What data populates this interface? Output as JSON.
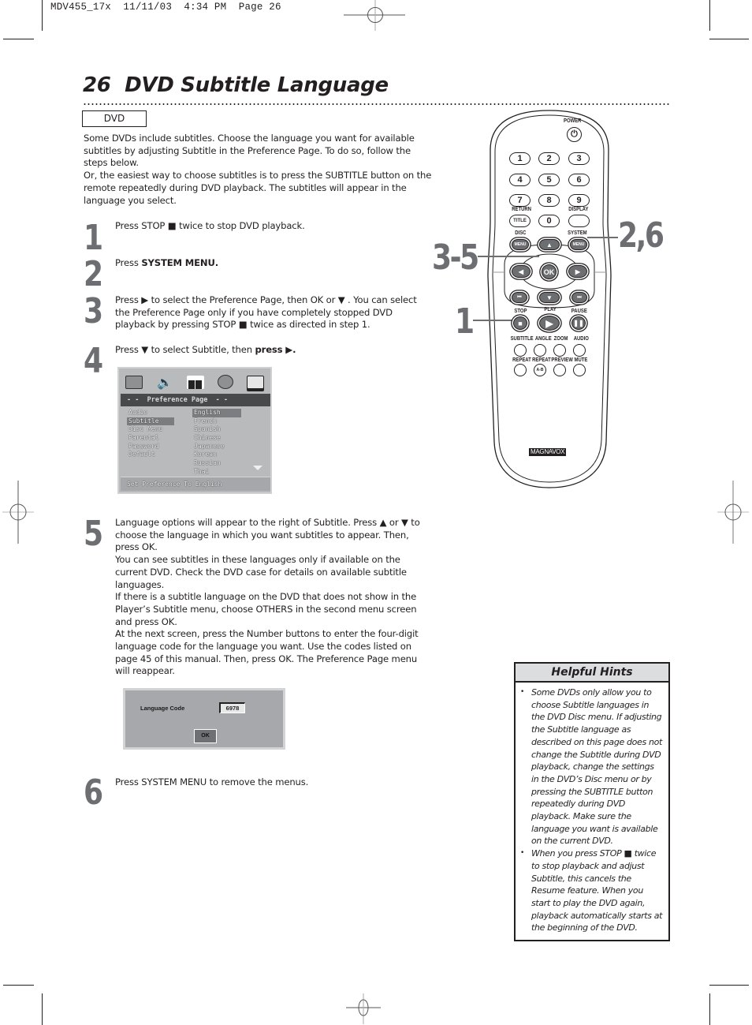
{
  "slug": "MDV455_17x  11/11/03  4:34 PM  Page 26",
  "page": {
    "number": "26",
    "title": "DVD Subtitle Language",
    "badge": "DVD"
  },
  "intro": [
    "Some DVDs include subtitles. Choose the language you want for available subtitles by adjusting Subtitle in the Preference Page. To do so, follow the steps below.",
    "Or, the easiest way to choose subtitles is to press the SUBTITLE button on the remote repeatedly during DVD playback. The subtitles will appear in the language you select."
  ],
  "steps": [
    {
      "num": "1",
      "parts": [
        "Press STOP ■ twice to stop DVD playback."
      ]
    },
    {
      "num": "2",
      "pre": "Press ",
      "bold": "SYSTEM MENU."
    },
    {
      "num": "3",
      "parts": [
        "Press ▶ to select the Preference Page, then OK or ▼ . You can select the Preference Page only if you have completely stopped DVD playback by pressing STOP ■ twice as directed in step 1."
      ]
    },
    {
      "num": "4",
      "pre": "Press ▼ to select Subtitle, then ",
      "bold": "press ▶."
    },
    {
      "num": "5",
      "parts": [
        "Language options will appear to the right of Subtitle. Press ▲ or ▼ to choose the language in which you want subtitles to appear. Then, press OK.",
        "You can see subtitles in these languages only if available on the current DVD. Check the DVD case for details on available subtitle languages.",
        "If there is a subtitle language on the DVD that does not show in the Player’s Subtitle menu, choose OTHERS in the second menu screen and press OK.",
        "At the next screen, press the Number buttons to enter the four-digit language code for the language you want. Use the codes listed on page 45 of this manual. Then, press OK. The Preference Page menu will reappear."
      ]
    },
    {
      "num": "6",
      "parts": [
        "Press SYSTEM MENU to remove the menus."
      ]
    }
  ],
  "preference_screen": {
    "header": "- -  Preference Page  - -",
    "icons": [
      "general-setup-icon",
      "speaker-setup-icon",
      "dolby-setup-icon",
      "video-setup-icon",
      "preference-icon"
    ],
    "dolby_label": "Dolby",
    "menu": [
      "Audio",
      "Subtitle",
      "Disc Menu",
      "Parental",
      "Password",
      "Default"
    ],
    "selected_menu": "Subtitle",
    "options": [
      "English",
      "French",
      "Spanish",
      "Chinese",
      "Japanese",
      "Korean",
      "Russian",
      "Thai"
    ],
    "selected_option": "English",
    "status": "Set Preference To English"
  },
  "language_code_screen": {
    "label": "Language Code",
    "value": "6978",
    "ok": "OK"
  },
  "remote": {
    "power": "POWER",
    "numbers": [
      "1",
      "2",
      "3",
      "4",
      "5",
      "6",
      "7",
      "8",
      "9",
      "0"
    ],
    "return": "RETURN",
    "title": "TITLE",
    "display": "DISPLAY",
    "disc": "DISC",
    "system": "SYSTEM",
    "menu": "MENU",
    "ok": "OK",
    "stop": "STOP",
    "play": "PLAY",
    "pause": "PAUSE",
    "row1": [
      "SUBTITLE",
      "ANGLE",
      "ZOOM",
      "AUDIO"
    ],
    "row2": [
      "REPEAT",
      "REPEAT",
      "PREVIEW",
      "MUTE"
    ],
    "ab": "A-B",
    "brand": "MAGNAVOX",
    "callouts": {
      "system": "2,6",
      "arrows": "3-5",
      "stop": "1"
    }
  },
  "hints": {
    "title": "Helpful Hints",
    "items": [
      "Some DVDs only allow you to choose Subtitle languages in the DVD Disc menu. If adjusting the Subtitle language as described on this page does not change the Subtitle during DVD playback, change the settings in the DVD’s Disc menu or by pressing the SUBTITLE button repeatedly during DVD playback. Make sure the language you want is available on the current DVD.",
      "When you press STOP ■ twice to stop playback and adjust Subtitle, this cancels the Resume feature. When you start to play the DVD again, playback automatically starts at the beginning of the DVD."
    ]
  }
}
